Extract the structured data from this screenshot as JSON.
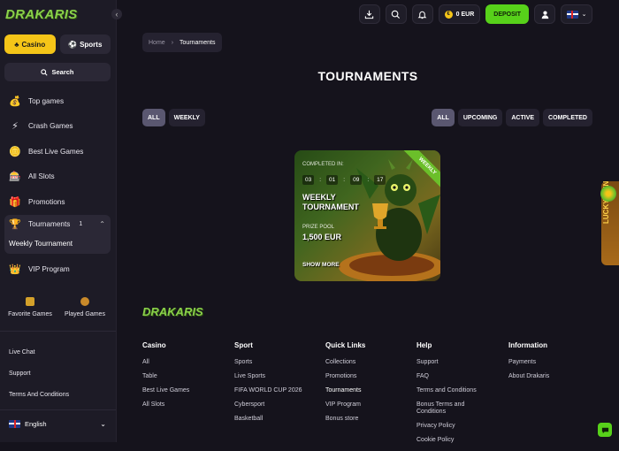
{
  "brand": {
    "logo": "DRAKARIS"
  },
  "sidebar": {
    "tabs": [
      {
        "label": "Casino"
      },
      {
        "label": "Sports"
      }
    ],
    "search_label": "Search",
    "items": [
      {
        "label": "Top games"
      },
      {
        "label": "Crash Games"
      },
      {
        "label": "Best Live Games"
      },
      {
        "label": "All Slots"
      },
      {
        "label": "Promotions"
      },
      {
        "label": "Tournaments",
        "badge": "1",
        "sub": "Weekly Tournament"
      },
      {
        "label": "VIP Program"
      }
    ],
    "favorites": {
      "fav": "Favorite Games",
      "played": "Played Games"
    },
    "links": [
      "Live Chat",
      "Support",
      "Terms And Conditions"
    ],
    "language": "English"
  },
  "header": {
    "balance": "0 EUR",
    "deposit": "DEPOSIT"
  },
  "breadcrumb": {
    "home": "Home",
    "current": "Tournaments"
  },
  "page": {
    "title": "TOURNAMENTS"
  },
  "filters": {
    "left": [
      "ALL",
      "WEEKLY"
    ],
    "right": [
      "ALL",
      "UPCOMING",
      "ACTIVE",
      "COMPLETED"
    ]
  },
  "card": {
    "ribbon": "WEEKLY",
    "status_label": "COMPLETED IN:",
    "countdown": [
      "03",
      "01",
      "09",
      "17"
    ],
    "title_line1": "WEEKLY",
    "title_line2": "TOURNAMENT",
    "prize_label": "PRIZE POOL",
    "prize": "1,500 EUR",
    "show_more": "SHOW MORE"
  },
  "lucky_spin": "LUCKY SPIN",
  "footer": {
    "logo": "DRAKARIS",
    "columns": [
      {
        "title": "Casino",
        "links": [
          "All",
          "Table",
          "Best Live Games",
          "All Slots"
        ]
      },
      {
        "title": "Sport",
        "links": [
          "Sports",
          "Live Sports",
          "FIFA WORLD CUP 2026",
          "Cybersport",
          "Basketball"
        ]
      },
      {
        "title": "Quick Links",
        "links": [
          "Collections",
          "Promotions",
          "Tournaments",
          "VIP Program",
          "Bonus store"
        ]
      },
      {
        "title": "Help",
        "links": [
          "Support",
          "FAQ",
          "Terms and Conditions",
          "Bonus Terms and Conditions",
          "Privacy Policy",
          "Cookie Policy"
        ]
      },
      {
        "title": "Information",
        "links": [
          "Payments",
          "About Drakaris"
        ]
      }
    ]
  }
}
